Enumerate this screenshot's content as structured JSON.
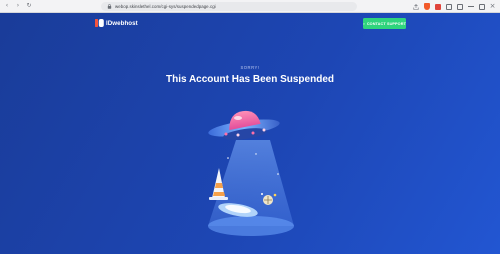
{
  "browser": {
    "url": "webop.skinslethel.com/cgi-sys/suspendedpage.cgi"
  },
  "header": {
    "logo_text": "IDwebhost",
    "cta_label": "CONTACT SUPPORT"
  },
  "main": {
    "eyebrow": "SORRY!",
    "title": "This Account Has Been Suspended"
  },
  "colors": {
    "background": "#1d46b4",
    "cta": "#2fd47d",
    "logo_accent": "#f5533d"
  }
}
